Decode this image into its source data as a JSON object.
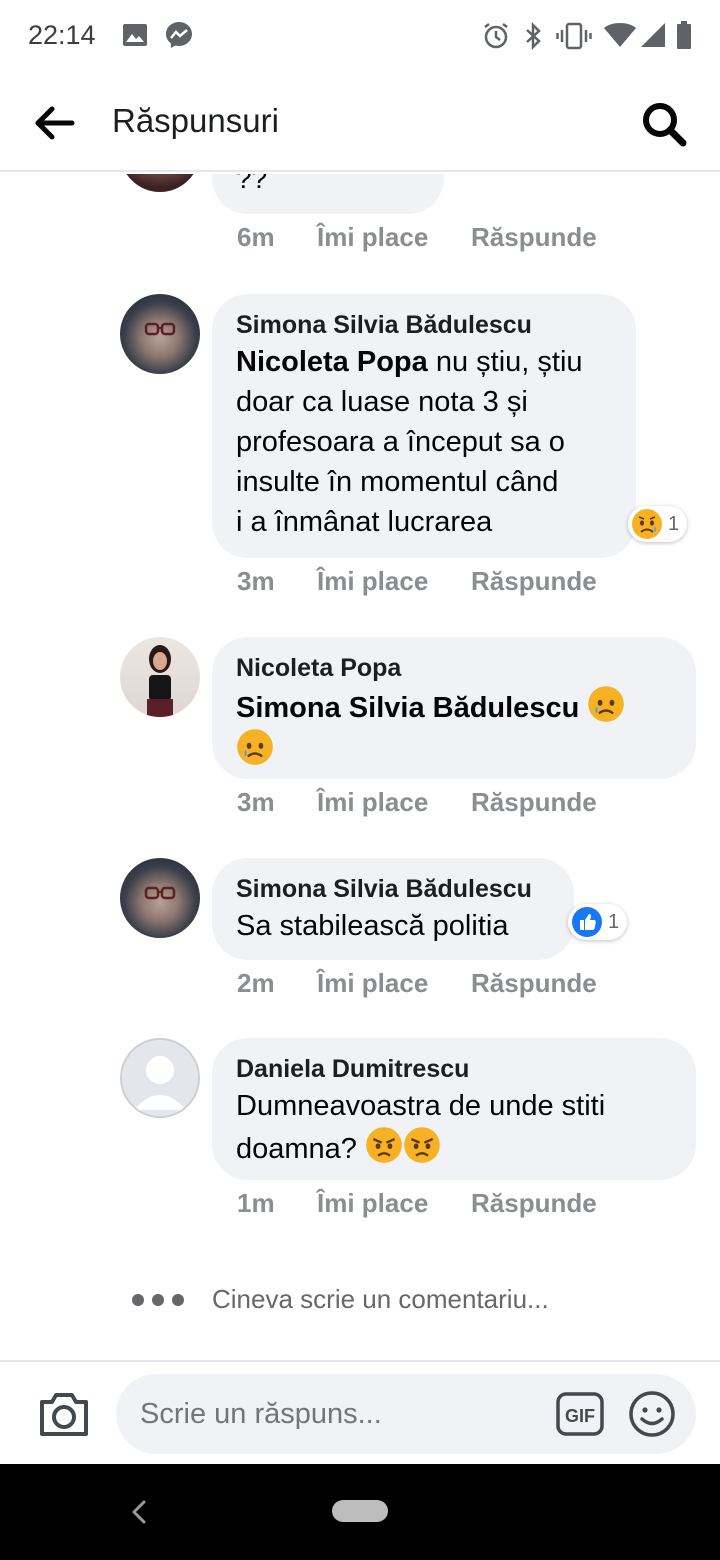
{
  "status_bar": {
    "time": "22:14",
    "icons": [
      "image-icon",
      "messenger-icon",
      "alarm-icon",
      "bluetooth-icon",
      "vibrate-icon",
      "wifi-icon",
      "signal-icon",
      "battery-icon"
    ]
  },
  "header": {
    "title": "Răspunsuri",
    "back_icon": "back-arrow-icon",
    "search_icon": "search-icon"
  },
  "actions": {
    "like": "Îmi place",
    "reply": "Răspunde"
  },
  "comments": [
    {
      "author": "",
      "text": "??",
      "time": "6m"
    },
    {
      "author": "Simona Silvia Bădulescu",
      "mention": "Nicoleta Popa",
      "text_lines": [
        "nu știu, știu",
        "doar ca luase nota 3 și",
        "profesoara a început sa o",
        "insulte în momentul când",
        "i a înmânat lucrarea"
      ],
      "time": "3m",
      "reaction": {
        "icon": "sad-emoji-icon",
        "count": "1"
      }
    },
    {
      "author": "Nicoleta Popa",
      "mention": "Simona Silvia Bădulescu",
      "emojis": [
        "crying-face",
        "crying-face"
      ],
      "time": "3m"
    },
    {
      "author": "Simona Silvia Bădulescu",
      "text": "Sa stabilească politia",
      "time": "2m",
      "reaction": {
        "icon": "like-icon",
        "count": "1"
      }
    },
    {
      "author": "Daniela Dumitrescu",
      "text_lines": [
        "Dumneavoastra de unde stiti",
        "doamna?"
      ],
      "emojis": [
        "angry-face",
        "angry-face"
      ],
      "time": "1m"
    }
  ],
  "typing_indicator": "Cineva scrie un comentariu...",
  "composer": {
    "placeholder": "Scrie un răspuns...",
    "gif_label": "GIF"
  },
  "colors": {
    "bubble": "#f0f2f5",
    "meta_text": "#8a8d91",
    "like_blue": "#1877f2",
    "emoji_yellow": "#f7b125"
  }
}
